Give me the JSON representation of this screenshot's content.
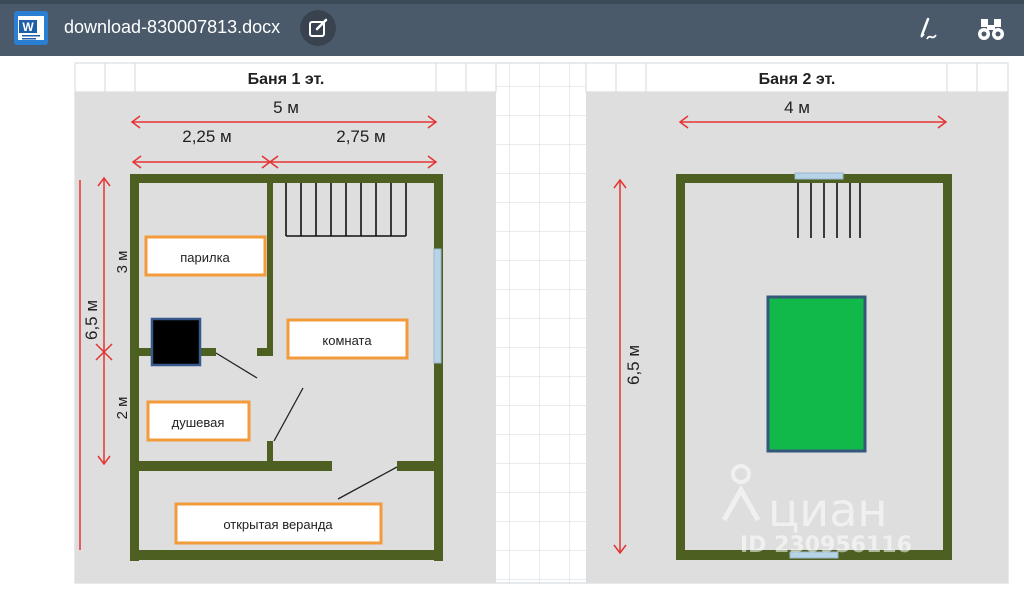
{
  "app": {
    "file_name": "download-830007813.docx",
    "icons": {
      "app_icon": "word-icon",
      "edit": "edit-icon",
      "pen": "pen-icon",
      "find": "binoculars-icon"
    },
    "colors": {
      "toolbar": "#4a5a6b",
      "wall": "#4e5f22",
      "dimension": "#e53333",
      "label_border": "#f39a3a",
      "pool": "#11b84a"
    }
  },
  "floor1": {
    "title": "Баня 1 эт.",
    "dim_total_width": "5 м",
    "dim_left_width": "2,25 м",
    "dim_right_width": "2,75 м",
    "dim_total_height": "6,5 м",
    "dim_upper_height": "3 м",
    "dim_lower_height": "2 м",
    "rooms": {
      "steam_room": "парилка",
      "room": "комната",
      "shower": "душевая",
      "veranda": "открытая веранда"
    }
  },
  "floor2": {
    "title": "Баня 2 эт.",
    "dim_width": "4 м",
    "dim_height": "6,5 м"
  },
  "watermark": {
    "brand": "циан",
    "id_text": "ID 230956116"
  }
}
